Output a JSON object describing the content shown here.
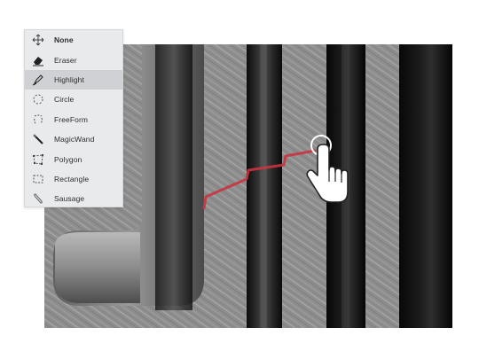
{
  "tool_menu": {
    "items": [
      {
        "label": "None",
        "icon": "move-arrows-icon"
      },
      {
        "label": "Eraser",
        "icon": "eraser-icon"
      },
      {
        "label": "Highlight",
        "icon": "highlighter-icon"
      },
      {
        "label": "Circle",
        "icon": "dashed-circle-icon"
      },
      {
        "label": "FreeForm",
        "icon": "freeform-icon"
      },
      {
        "label": "MagicWand",
        "icon": "magic-wand-icon"
      },
      {
        "label": "Polygon",
        "icon": "polygon-icon"
      },
      {
        "label": "Rectangle",
        "icon": "dashed-rectangle-icon"
      },
      {
        "label": "Sausage",
        "icon": "sausage-icon"
      }
    ],
    "selected": "Highlight"
  },
  "colors": {
    "menu_bg": "#e9eaec",
    "menu_active": "#cfd1d4",
    "annotation_line": "#c8343f",
    "cursor_outline": "#ffffff"
  }
}
